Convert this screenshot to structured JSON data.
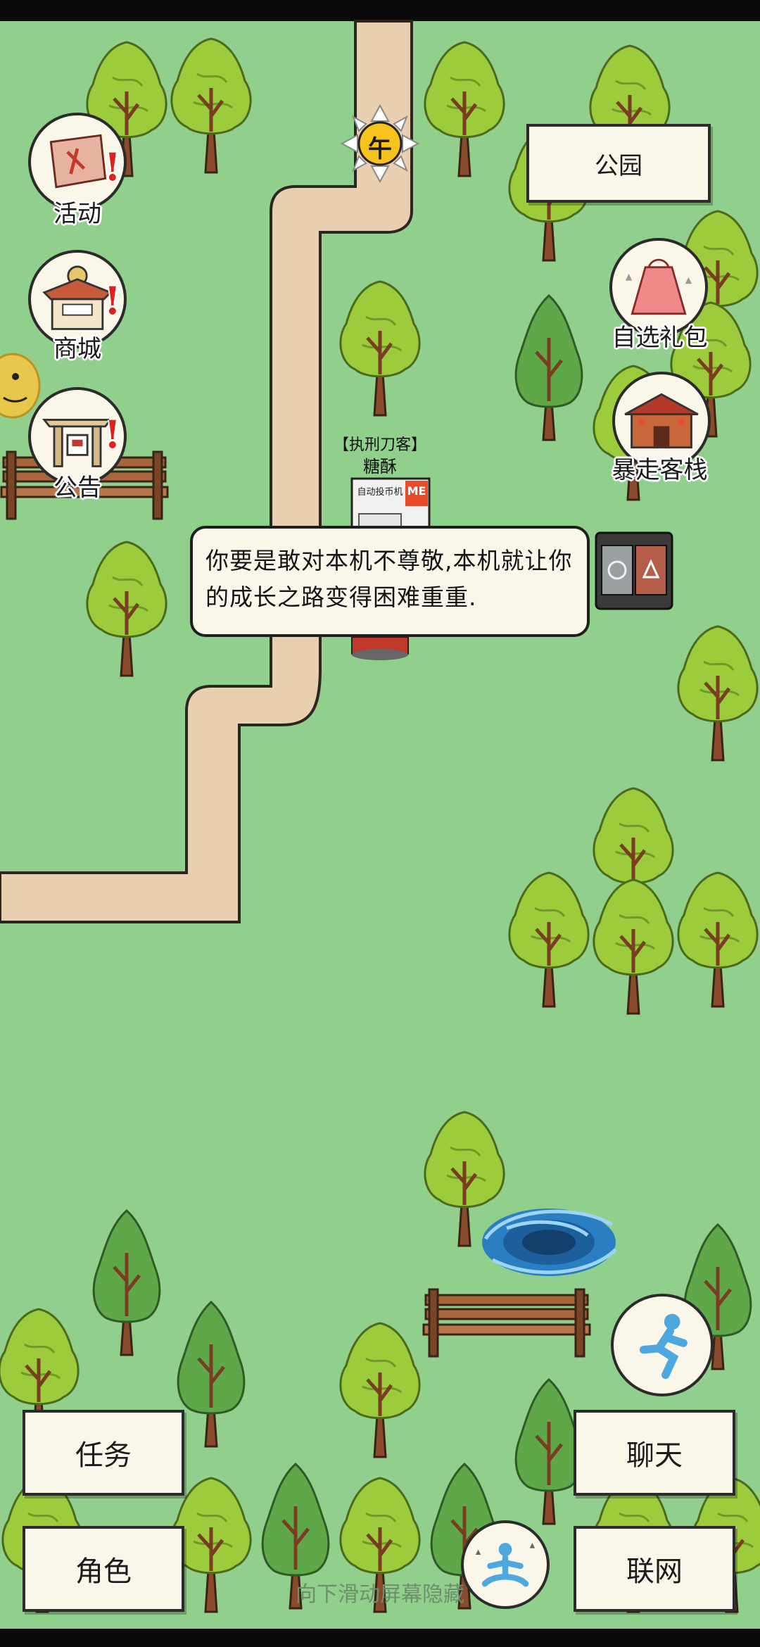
{
  "location": "公园",
  "time_of_day": "午",
  "left_menu": [
    {
      "label": "活动",
      "icon": "event-scroll-icon",
      "alert": "!"
    },
    {
      "label": "商城",
      "icon": "shop-stall-icon",
      "alert": "!"
    },
    {
      "label": "公告",
      "icon": "notice-gate-icon",
      "alert": "!"
    }
  ],
  "right_menu": [
    {
      "label": "自选礼包",
      "icon": "gift-bag-icon"
    },
    {
      "label": "暴走客栈",
      "icon": "inn-building-icon"
    }
  ],
  "npc": {
    "title": "【执刑刀客】",
    "name": "糖酥",
    "sign_text": "自动投币机",
    "sign_text2": "ME"
  },
  "dialog": "你要是敢对本机不尊敬,本机就让你的成长之路变得困难重重.",
  "bottom_buttons": {
    "quest": "任务",
    "character": "角色",
    "chat": "聊天",
    "online": "联网"
  },
  "hint": "向下滑动屏幕隐藏",
  "icons": {
    "run": "running-figure-icon",
    "meditate": "meditation-figure-icon",
    "portal": "whirlpool-portal-icon",
    "trash": "recycle-bin-icon"
  },
  "colors": {
    "grass": "#90cf8c",
    "path": "#e8cfb0",
    "alert": "#e0201b",
    "panel": "#fbf6ea"
  }
}
